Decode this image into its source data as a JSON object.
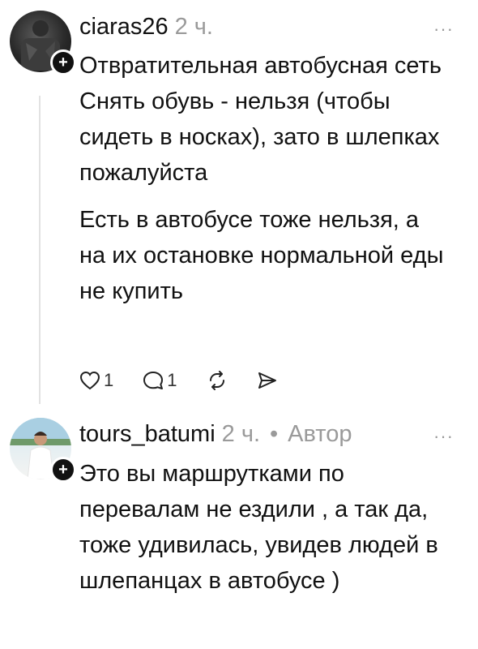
{
  "comments": [
    {
      "username": "ciaras26",
      "time": "2 ч.",
      "author_badge": "",
      "more_icon": "ellipsis-icon",
      "paragraphs": [
        "Отвратительная автобусная сеть\nСнять обувь - нельзя (чтобы сидеть в носках), зато в шлепках пожалуйста",
        "Есть в автобусе тоже нельзя, а на их остановке нормальной еды не купить"
      ],
      "likes": "1",
      "replies": "1"
    },
    {
      "username": "tours_batumi",
      "time": "2 ч.",
      "separator": "•",
      "author_badge": "Автор",
      "more_icon": "ellipsis-icon",
      "paragraphs": [
        "Это вы маршрутками по перевалам не ездили , а так да, тоже удивилась, увидев людей в шлепанцах в автобусе )"
      ]
    }
  ],
  "ui": {
    "more_glyph": "···",
    "plus_glyph": "+"
  }
}
